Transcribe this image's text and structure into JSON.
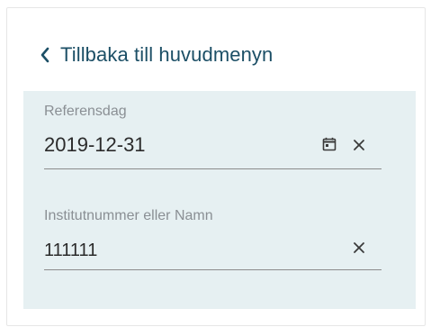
{
  "back": {
    "label": "Tillbaka till huvudmenyn",
    "icon": "chevron-left-icon"
  },
  "fields": {
    "reference_date": {
      "label": "Referensdag",
      "value": "2019-12-31",
      "icons": [
        "calendar-icon",
        "clear-icon"
      ]
    },
    "institute": {
      "label": "Institutnummer eller Namn",
      "value": "111111",
      "icons": [
        "clear-icon"
      ]
    }
  },
  "colors": {
    "link": "#1c4f66",
    "filter_background": "#e6f0f2",
    "label": "#8a8f94",
    "value": "#2b2b2b",
    "underline": "#8c8c8c"
  }
}
